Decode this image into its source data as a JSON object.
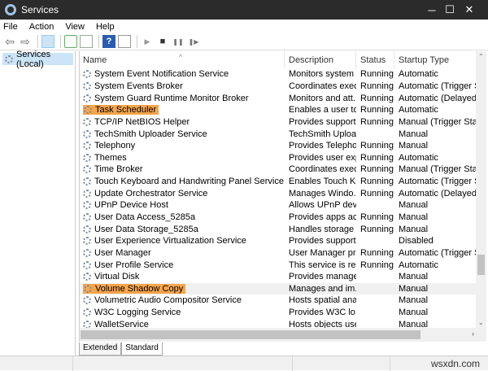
{
  "window": {
    "title": "Services",
    "minimize": "─",
    "maximize": "☐",
    "close": "✕"
  },
  "menu": [
    "File",
    "Action",
    "View",
    "Help"
  ],
  "toolbar": {
    "back": "⇦",
    "forward": "⇨",
    "play": "▶",
    "stop": "■",
    "pause": "❚❚",
    "restart": "❚▶"
  },
  "left_pane": {
    "item": "Services (Local)"
  },
  "columns": [
    "Name",
    "Description",
    "Status",
    "Startup Type"
  ],
  "rows": [
    [
      "System Event Notification Service",
      "Monitors system ...",
      "Running",
      "Automatic"
    ],
    [
      "System Events Broker",
      "Coordinates exec...",
      "Running",
      "Automatic (Trigger Start"
    ],
    [
      "System Guard Runtime Monitor Broker",
      "Monitors and att...",
      "Running",
      "Automatic (Delayed Sta"
    ],
    [
      "Task Scheduler",
      "Enables a user to ...",
      "Running",
      "Automatic"
    ],
    [
      "TCP/IP NetBIOS Helper",
      "Provides support ...",
      "Running",
      "Manual (Trigger Start)"
    ],
    [
      "TechSmith Uploader Service",
      "TechSmith Uploa...",
      "",
      "Manual"
    ],
    [
      "Telephony",
      "Provides Telepho...",
      "Running",
      "Manual"
    ],
    [
      "Themes",
      "Provides user exp...",
      "Running",
      "Automatic"
    ],
    [
      "Time Broker",
      "Coordinates exec...",
      "Running",
      "Manual (Trigger Start)"
    ],
    [
      "Touch Keyboard and Handwriting Panel Service",
      "Enables Touch Ke...",
      "Running",
      "Automatic (Trigger Start"
    ],
    [
      "Update Orchestrator Service",
      "Manages Windo...",
      "Running",
      "Automatic (Delayed Sta"
    ],
    [
      "UPnP Device Host",
      "Allows UPnP devi...",
      "",
      "Manual"
    ],
    [
      "User Data Access_5285a",
      "Provides apps ac...",
      "Running",
      "Manual"
    ],
    [
      "User Data Storage_5285a",
      "Handles storage ...",
      "Running",
      "Manual"
    ],
    [
      "User Experience Virtualization Service",
      "Provides support ...",
      "",
      "Disabled"
    ],
    [
      "User Manager",
      "User Manager pr...",
      "Running",
      "Automatic (Trigger Start"
    ],
    [
      "User Profile Service",
      "This service is res...",
      "Running",
      "Automatic"
    ],
    [
      "Virtual Disk",
      "Provides manage...",
      "",
      "Manual"
    ],
    [
      "Volume Shadow Copy",
      "Manages and im...",
      "",
      "Manual"
    ],
    [
      "Volumetric Audio Compositor Service",
      "Hosts spatial anal...",
      "",
      "Manual"
    ],
    [
      "W3C Logging Service",
      "Provides W3C lo...",
      "",
      "Manual"
    ],
    [
      "WalletService",
      "Hosts objects use...",
      "",
      "Manual"
    ]
  ],
  "highlighted": [
    3,
    18
  ],
  "tabs": [
    "Extended",
    "Standard"
  ],
  "watermark": "wsxdn.com"
}
